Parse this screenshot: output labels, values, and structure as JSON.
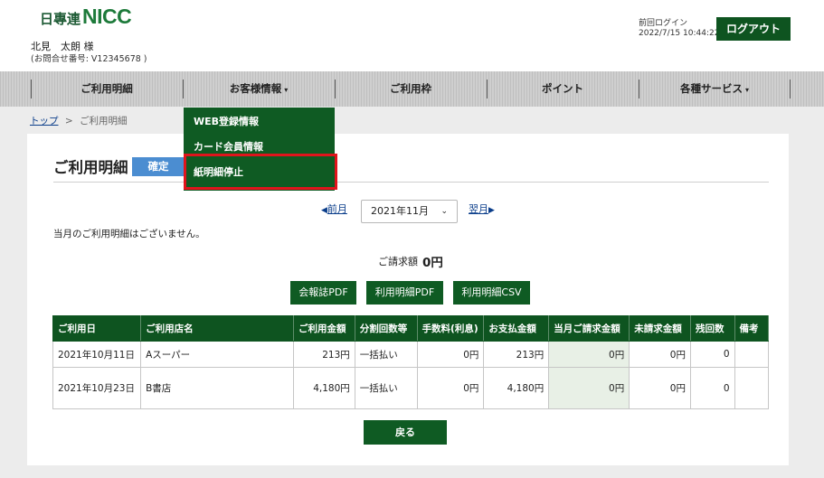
{
  "header": {
    "logo_prefix": "日專連",
    "logo_main": "NICC",
    "user_name": "北見　太朗 様",
    "inquiry_number": "(お問合せ番号: V12345678 )",
    "last_login_label": "前回ログイン",
    "last_login_time": "2022/7/15 10:44:22",
    "logout_label": "ログアウト"
  },
  "nav": {
    "items": [
      {
        "label": "ご利用明細"
      },
      {
        "label": "お客様情報",
        "caret": "▾"
      },
      {
        "label": "ご利用枠"
      },
      {
        "label": "ポイント"
      },
      {
        "label": "各種サービス",
        "caret": "▾"
      }
    ]
  },
  "dropdown": {
    "items": [
      {
        "label": "WEB登録情報"
      },
      {
        "label": "カード会員情報"
      },
      {
        "label": "紙明細停止"
      }
    ],
    "highlight_color": "#e0141c"
  },
  "breadcrumb": {
    "home": "トップ",
    "separator": ">",
    "current": "ご利用明細"
  },
  "page": {
    "title": "ご利用明細",
    "status_badge": "確定",
    "prev_arrow": "◀",
    "prev_label": "前月",
    "next_label": "翌月",
    "next_arrow": "▶",
    "month_selected": "2021年11月",
    "no_data_message": "当月のご利用明細はございません。",
    "billing_label": "ご請求額",
    "billing_amount": "0円",
    "buttons": {
      "newsletter_pdf": "会報誌PDF",
      "statement_pdf": "利用明細PDF",
      "statement_csv": "利用明細CSV",
      "back": "戻る"
    }
  },
  "table": {
    "columns": [
      "ご利用日",
      "ご利用店名",
      "ご利用金額",
      "分割回数等",
      "手数料(利息)",
      "お支払金額",
      "当月ご請求金額",
      "未請求金額",
      "残回数",
      "備考"
    ],
    "rows": [
      [
        "2021年10月11日",
        "Aスーパー",
        "213円",
        "一括払い",
        "0円",
        "213円",
        "0円",
        "0円",
        "0",
        ""
      ],
      [
        "2021年10月23日",
        "B書店",
        "4,180円",
        "一括払い",
        "0円",
        "4,180円",
        "0円",
        "0円",
        "0",
        ""
      ]
    ]
  },
  "colors": {
    "brand_green": "#0e5420",
    "badge_blue": "#4b8dd1",
    "link_blue": "#0a3d8a"
  }
}
